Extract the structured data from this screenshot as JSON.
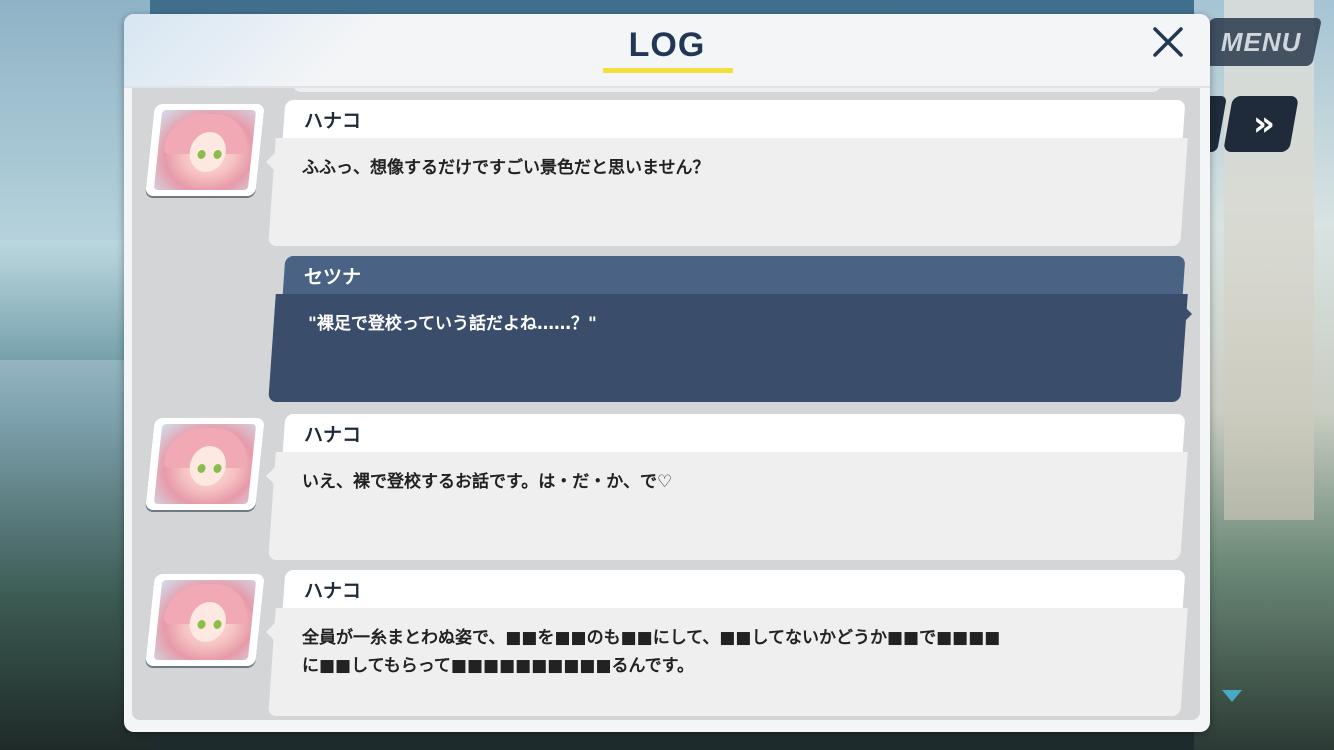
{
  "log": {
    "title": "LOG",
    "close_label": "×"
  },
  "hud": {
    "menu_label": "MENU",
    "skip_label": "»"
  },
  "entries": [
    {
      "speaker": "ハナコ",
      "text": "ふふっ、想像するだけですごい景色だと思いません？",
      "is_player": false
    },
    {
      "speaker": "セツナ",
      "text": "\"裸足で登校っていう話だよね……？\"",
      "is_player": true
    },
    {
      "speaker": "ハナコ",
      "text": "いえ、裸で登校するお話です。は・だ・か、で♡",
      "is_player": false
    },
    {
      "speaker": "ハナコ",
      "text": "全員が一糸まとわぬ姿で、■■を■■のも■■にして、■■してないかどうか■■で■■■■",
      "text2": "に■■してもらって■■■■■■■■■■るんです。",
      "is_player": false
    }
  ],
  "colors": {
    "title": "#223754",
    "title_underline": "#f3e03a",
    "player_bubble": "#3a4d6b",
    "player_header": "#4a6284",
    "npc_bubble": "#efefef"
  }
}
